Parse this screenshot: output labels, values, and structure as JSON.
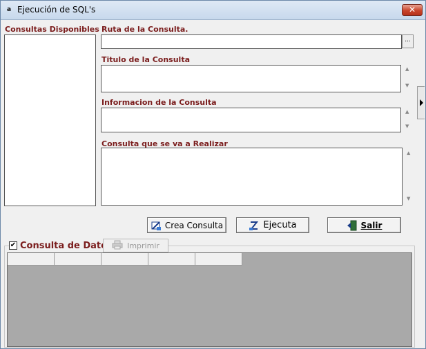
{
  "window": {
    "title": "Ejecución de SQL's",
    "close_glyph": "✕",
    "icon_glyph": "a"
  },
  "left_panel": {
    "label": "Consultas Disponibles",
    "items": []
  },
  "ruta": {
    "label": "Ruta de la Consulta.",
    "value": "",
    "browse_label": "..."
  },
  "titulo": {
    "label": "Titulo de la Consulta",
    "value": ""
  },
  "informacion": {
    "label": "Informacion de la Consulta",
    "value": ""
  },
  "consulta": {
    "label": "Consulta que se va a Realizar",
    "value": ""
  },
  "buttons": {
    "crea_consulta": "Crea Consulta",
    "ejecuta": "Ejecuta",
    "salir": "Salir"
  },
  "datos": {
    "checkbox_label": "Consulta de Datos",
    "checked": true,
    "check_glyph": "✔",
    "print_label": "Imprimir",
    "columns": [
      "",
      "",
      "",
      "",
      "",
      "",
      ""
    ]
  },
  "colors": {
    "label_color": "#7a1c1c",
    "grid_background": "#a9a9a9"
  }
}
